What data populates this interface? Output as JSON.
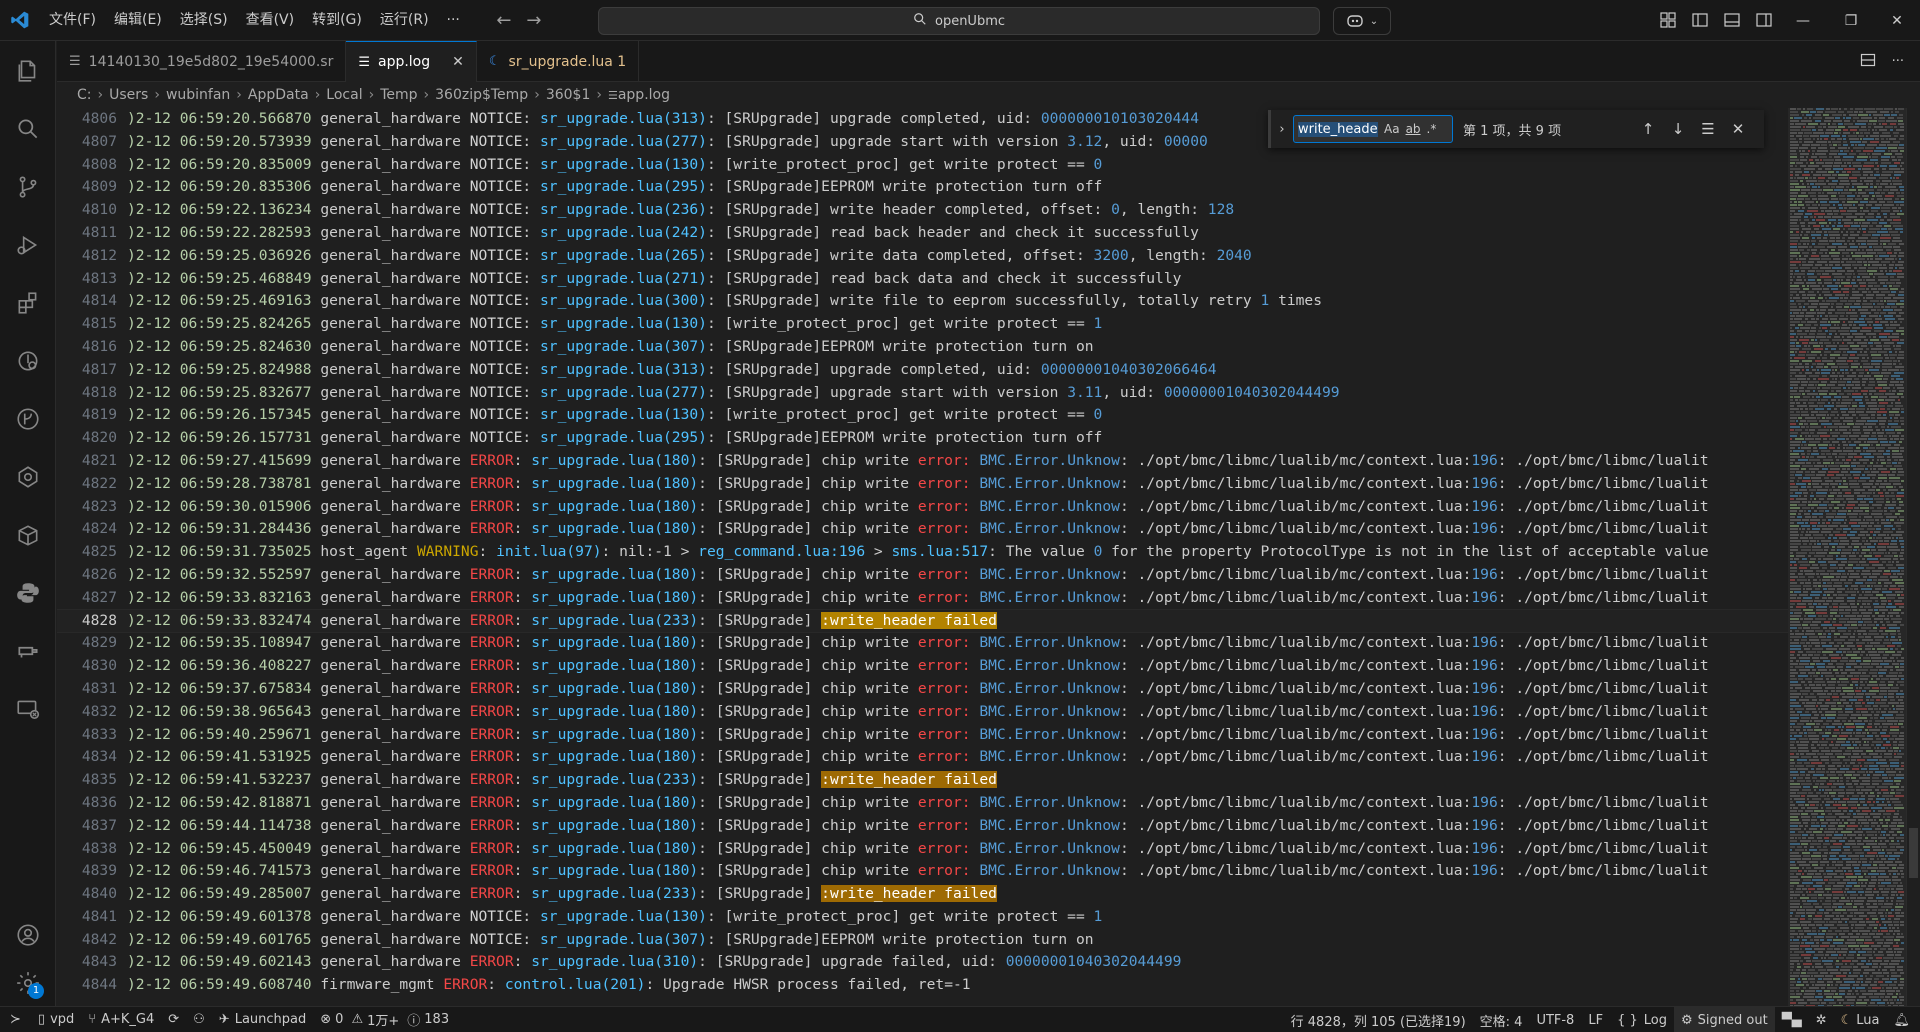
{
  "titlebar": {
    "menus": [
      "文件(F)",
      "编辑(E)",
      "选择(S)",
      "查看(V)",
      "转到(G)",
      "运行(R)",
      "···"
    ],
    "search_text": "openUbmc"
  },
  "tabs": [
    {
      "label": "14140130_19e5d802_19e54000.sr",
      "icon": "file-icon"
    },
    {
      "label": "app.log",
      "icon": "log-icon",
      "active": true
    },
    {
      "label": "sr_upgrade.lua 1",
      "icon": "lua-icon"
    }
  ],
  "breadcrumb": [
    "C:",
    "Users",
    "wubinfan",
    "AppData",
    "Local",
    "Temp",
    "360zip$Temp",
    "360$1",
    "app.log"
  ],
  "find": {
    "query": "write_header",
    "opt_case": "Aa",
    "opt_word": "ab",
    "opt_regex": ".*",
    "result": "第 1 项，共 9 项"
  },
  "log_lines": [
    {
      "n": "4806",
      "ts": ")2-12 06:59:20.566870",
      "mod": "general_hardware",
      "lvl": "NOTICE",
      "file": "sr_upgrade.lua(313)",
      "msg": "[SRUpgrade] upgrade completed, uid: ",
      "num": "000000010103020444",
      "msg2": ""
    },
    {
      "n": "4807",
      "ts": ")2-12 06:59:20.573939",
      "mod": "general_hardware",
      "lvl": "NOTICE",
      "file": "sr_upgrade.lua(277)",
      "msg": "[SRUpgrade] upgrade start with version ",
      "num": "3.12",
      "msg2": ", uid: ",
      "num2": "00000"
    },
    {
      "n": "4808",
      "ts": ")2-12 06:59:20.835009",
      "mod": "general_hardware",
      "lvl": "NOTICE",
      "file": "sr_upgrade.lua(130)",
      "msg": "[write_protect_proc] get write protect == ",
      "num": "0",
      "msg2": ""
    },
    {
      "n": "4809",
      "ts": ")2-12 06:59:20.835306",
      "mod": "general_hardware",
      "lvl": "NOTICE",
      "file": "sr_upgrade.lua(295)",
      "msg": "[SRUpgrade]EEPROM write protection turn off",
      "num": "",
      "msg2": ""
    },
    {
      "n": "4810",
      "ts": ")2-12 06:59:22.136234",
      "mod": "general_hardware",
      "lvl": "NOTICE",
      "file": "sr_upgrade.lua(236)",
      "msg": "[SRUpgrade] write header completed, offset: ",
      "num": "0",
      "msg2": ", length: ",
      "num2": "128"
    },
    {
      "n": "4811",
      "ts": ")2-12 06:59:22.282593",
      "mod": "general_hardware",
      "lvl": "NOTICE",
      "file": "sr_upgrade.lua(242)",
      "msg": "[SRUpgrade] read back header and check it successfully",
      "num": "",
      "msg2": ""
    },
    {
      "n": "4812",
      "ts": ")2-12 06:59:25.036926",
      "mod": "general_hardware",
      "lvl": "NOTICE",
      "file": "sr_upgrade.lua(265)",
      "msg": "[SRUpgrade] write data completed, offset: ",
      "num": "3200",
      "msg2": ", length: ",
      "num2": "2040"
    },
    {
      "n": "4813",
      "ts": ")2-12 06:59:25.468849",
      "mod": "general_hardware",
      "lvl": "NOTICE",
      "file": "sr_upgrade.lua(271)",
      "msg": "[SRUpgrade] read back data and check it successfully",
      "num": "",
      "msg2": ""
    },
    {
      "n": "4814",
      "ts": ")2-12 06:59:25.469163",
      "mod": "general_hardware",
      "lvl": "NOTICE",
      "file": "sr_upgrade.lua(300)",
      "msg": "[SRUpgrade] write file to eeprom successfully, totally retry ",
      "num": "1",
      "msg2": " times"
    },
    {
      "n": "4815",
      "ts": ")2-12 06:59:25.824265",
      "mod": "general_hardware",
      "lvl": "NOTICE",
      "file": "sr_upgrade.lua(130)",
      "msg": "[write_protect_proc] get write protect == ",
      "num": "1",
      "msg2": ""
    },
    {
      "n": "4816",
      "ts": ")2-12 06:59:25.824630",
      "mod": "general_hardware",
      "lvl": "NOTICE",
      "file": "sr_upgrade.lua(307)",
      "msg": "[SRUpgrade]EEPROM write protection turn on",
      "num": "",
      "msg2": ""
    },
    {
      "n": "4817",
      "ts": ")2-12 06:59:25.824988",
      "mod": "general_hardware",
      "lvl": "NOTICE",
      "file": "sr_upgrade.lua(313)",
      "msg": "[SRUpgrade] upgrade completed, uid: ",
      "num": "00000001040302066464",
      "msg2": ""
    },
    {
      "n": "4818",
      "ts": ")2-12 06:59:25.832677",
      "mod": "general_hardware",
      "lvl": "NOTICE",
      "file": "sr_upgrade.lua(277)",
      "msg": "[SRUpgrade] upgrade start with version ",
      "num": "3.11",
      "msg2": ", uid: ",
      "num2": "00000001040302044499"
    },
    {
      "n": "4819",
      "ts": ")2-12 06:59:26.157345",
      "mod": "general_hardware",
      "lvl": "NOTICE",
      "file": "sr_upgrade.lua(130)",
      "msg": "[write_protect_proc] get write protect == ",
      "num": "0",
      "msg2": ""
    },
    {
      "n": "4820",
      "ts": ")2-12 06:59:26.157731",
      "mod": "general_hardware",
      "lvl": "NOTICE",
      "file": "sr_upgrade.lua(295)",
      "msg": "[SRUpgrade]EEPROM write protection turn off",
      "num": "",
      "msg2": ""
    },
    {
      "n": "4821",
      "ts": ")2-12 06:59:27.415699",
      "mod": "general_hardware",
      "lvl": "ERROR",
      "file": "sr_upgrade.lua(180)",
      "chip": true
    },
    {
      "n": "4822",
      "ts": ")2-12 06:59:28.738781",
      "mod": "general_hardware",
      "lvl": "ERROR",
      "file": "sr_upgrade.lua(180)",
      "chip": true
    },
    {
      "n": "4823",
      "ts": ")2-12 06:59:30.015906",
      "mod": "general_hardware",
      "lvl": "ERROR",
      "file": "sr_upgrade.lua(180)",
      "chip": true
    },
    {
      "n": "4824",
      "ts": ")2-12 06:59:31.284436",
      "mod": "general_hardware",
      "lvl": "ERROR",
      "file": "sr_upgrade.lua(180)",
      "chip": true
    },
    {
      "n": "4825",
      "ts": ")2-12 06:59:31.735025",
      "mod": "host_agent",
      "lvl": "WARNING",
      "file": "init.lua(97)",
      "warn": true
    },
    {
      "n": "4826",
      "ts": ")2-12 06:59:32.552597",
      "mod": "general_hardware",
      "lvl": "ERROR",
      "file": "sr_upgrade.lua(180)",
      "chip": true
    },
    {
      "n": "4827",
      "ts": ")2-12 06:59:33.832163",
      "mod": "general_hardware",
      "lvl": "ERROR",
      "file": "sr_upgrade.lua(180)",
      "chip": true
    },
    {
      "n": "4828",
      "ts": ")2-12 06:59:33.832474",
      "mod": "general_hardware",
      "lvl": "ERROR",
      "file": "sr_upgrade.lua(233)",
      "wh": true,
      "current": true
    },
    {
      "n": "4829",
      "ts": ")2-12 06:59:35.108947",
      "mod": "general_hardware",
      "lvl": "ERROR",
      "file": "sr_upgrade.lua(180)",
      "chip": true
    },
    {
      "n": "4830",
      "ts": ")2-12 06:59:36.408227",
      "mod": "general_hardware",
      "lvl": "ERROR",
      "file": "sr_upgrade.lua(180)",
      "chip": true
    },
    {
      "n": "4831",
      "ts": ")2-12 06:59:37.675834",
      "mod": "general_hardware",
      "lvl": "ERROR",
      "file": "sr_upgrade.lua(180)",
      "chip": true
    },
    {
      "n": "4832",
      "ts": ")2-12 06:59:38.965643",
      "mod": "general_hardware",
      "lvl": "ERROR",
      "file": "sr_upgrade.lua(180)",
      "chip": true
    },
    {
      "n": "4833",
      "ts": ")2-12 06:59:40.259671",
      "mod": "general_hardware",
      "lvl": "ERROR",
      "file": "sr_upgrade.lua(180)",
      "chip": true
    },
    {
      "n": "4834",
      "ts": ")2-12 06:59:41.531925",
      "mod": "general_hardware",
      "lvl": "ERROR",
      "file": "sr_upgrade.lua(180)",
      "chip": true
    },
    {
      "n": "4835",
      "ts": ")2-12 06:59:41.532237",
      "mod": "general_hardware",
      "lvl": "ERROR",
      "file": "sr_upgrade.lua(233)",
      "wh": true
    },
    {
      "n": "4836",
      "ts": ")2-12 06:59:42.818871",
      "mod": "general_hardware",
      "lvl": "ERROR",
      "file": "sr_upgrade.lua(180)",
      "chip": true
    },
    {
      "n": "4837",
      "ts": ")2-12 06:59:44.114738",
      "mod": "general_hardware",
      "lvl": "ERROR",
      "file": "sr_upgrade.lua(180)",
      "chip": true
    },
    {
      "n": "4838",
      "ts": ")2-12 06:59:45.450049",
      "mod": "general_hardware",
      "lvl": "ERROR",
      "file": "sr_upgrade.lua(180)",
      "chip": true
    },
    {
      "n": "4839",
      "ts": ")2-12 06:59:46.741573",
      "mod": "general_hardware",
      "lvl": "ERROR",
      "file": "sr_upgrade.lua(180)",
      "chip": true
    },
    {
      "n": "4840",
      "ts": ")2-12 06:59:49.285007",
      "mod": "general_hardware",
      "lvl": "ERROR",
      "file": "sr_upgrade.lua(233)",
      "wh": true
    },
    {
      "n": "4841",
      "ts": ")2-12 06:59:49.601378",
      "mod": "general_hardware",
      "lvl": "NOTICE",
      "file": "sr_upgrade.lua(130)",
      "msg": "[write_protect_proc] get write protect == ",
      "num": "1",
      "msg2": ""
    },
    {
      "n": "4842",
      "ts": ")2-12 06:59:49.601765",
      "mod": "general_hardware",
      "lvl": "NOTICE",
      "file": "sr_upgrade.lua(307)",
      "msg": "[SRUpgrade]EEPROM write protection turn on",
      "num": "",
      "msg2": ""
    },
    {
      "n": "4843",
      "ts": ")2-12 06:59:49.602143",
      "mod": "general_hardware",
      "lvl": "ERROR",
      "file": "sr_upgrade.lua(310)",
      "msg": "[SRUpgrade] upgrade failed, uid: ",
      "num": "00000001040302044499",
      "msg2": ""
    },
    {
      "n": "4844",
      "ts": ")2-12 06:59:49.608740",
      "mod": "firmware_mgmt",
      "lvl": "ERROR",
      "file": "control.lua(201)",
      "msg": "Upgrade HWSR process failed, ret=-1",
      "num": "",
      "msg2": ""
    }
  ],
  "chip_line": {
    "prefix": "[SRUpgrade] chip write ",
    "err": "error:",
    "bmc": "BMC.Error.Unknow",
    "path1": ": ./opt/bmc/libmc/lualib/mc/context.lua:",
    "lineno": "196",
    "path2": ": ./opt/bmc/libmc/lualit"
  },
  "warn_line": {
    "pre": "nil:-1 > ",
    "f1": "reg_command.lua:196",
    "mid": " > ",
    "f2": "sms.lua:517",
    "text": ": The value ",
    "val": "0",
    "rest": " for the property ProtocolType is not in the list of acceptable value"
  },
  "wh_line": {
    "prefix": "[SRUpgrade] ",
    "hl": ":write_header failed"
  },
  "statusbar": {
    "remote": "vpd",
    "branch": "A+K_G4",
    "launchpad": "Launchpad",
    "errors": "0",
    "warnings": "1万+",
    "info": "183",
    "position": "行 4828，列 105 (已选择19)",
    "spaces": "空格: 4",
    "encoding": "UTF-8",
    "eol": "LF",
    "language": "Log",
    "account": "Signed out",
    "lang2": "Lua"
  },
  "activity_badge": "1",
  "colors": {
    "accent": "#0078d4",
    "error": "#f44747",
    "notice": "#d4d4d4",
    "file": "#4fc1ff",
    "number": "#569cd6",
    "timestamp": "#b5cea8"
  }
}
